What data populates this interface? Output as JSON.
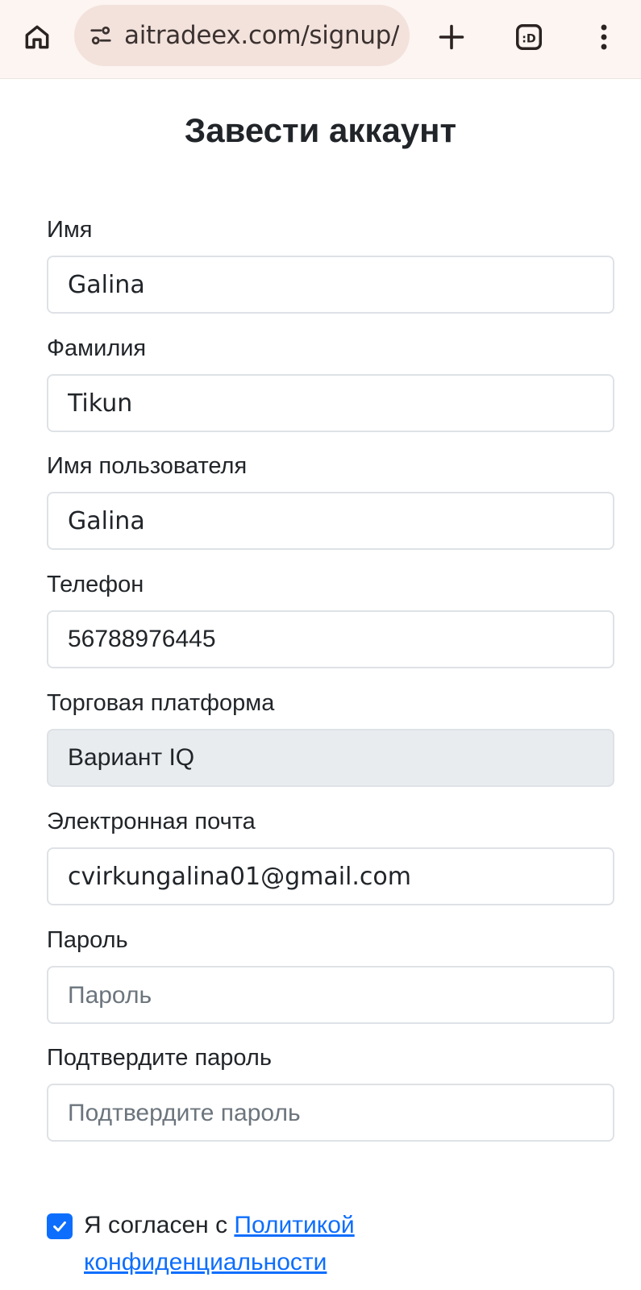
{
  "browser": {
    "url": "aitradeex.com/signup/",
    "icons": [
      "home-icon",
      "site-settings-icon",
      "new-tab-icon",
      "tab-switcher-icon",
      "more-menu-icon"
    ]
  },
  "page": {
    "title": "Завести аккаунт"
  },
  "form": {
    "first_name": {
      "label": "Имя",
      "value": "Galina"
    },
    "last_name": {
      "label": "Фамилия",
      "value": "Tikun"
    },
    "username": {
      "label": "Имя пользователя",
      "value": "Galina"
    },
    "phone": {
      "label": "Телефон",
      "value": "56788976445"
    },
    "platform": {
      "label": "Торговая платформа",
      "value": "Вариант IQ"
    },
    "email": {
      "label": "Электронная почта",
      "value": "cvirkungalina01@gmail.com"
    },
    "password": {
      "label": "Пароль",
      "placeholder": "Пароль",
      "value": ""
    },
    "confirm_password": {
      "label": "Подтвердите пароль",
      "placeholder": "Подтвердите пароль",
      "value": ""
    }
  },
  "agreement": {
    "checked": true,
    "prefix": "Я согласен с ",
    "link_text_1": "Политикой",
    "link_text_2": "конфиденциальности"
  },
  "colors": {
    "accent": "#0d6efd",
    "chrome_bg": "#fcf5f2",
    "urlbar_bg": "#f3e2dc",
    "input_border": "#dee2e6",
    "disabled_bg": "#e9ecef"
  }
}
